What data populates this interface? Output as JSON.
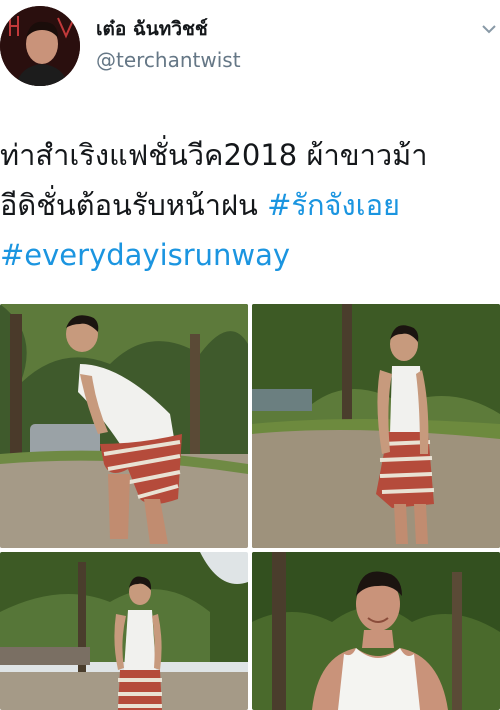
{
  "tweet": {
    "author": {
      "display_name": "เต๋อ ฉันทวิชช์",
      "handle": "@terchantwist",
      "avatar_icon": "profile-avatar"
    },
    "menu_icon": "chevron-down-icon",
    "text_lines": [
      {
        "text": "ท่าสำเริงแฟชั่นวีค2018 ผ้าขาวม้า",
        "hashtag": ""
      },
      {
        "text": "อีดิชั่นต้อนรับหน้าฝน ",
        "hashtag": "#รักจังเอย"
      },
      {
        "text": "",
        "hashtag": "#everydayisrunway"
      }
    ],
    "hashtag_color": "#1b95e0",
    "photos": [
      {
        "icon": "photo-man-bending-forward"
      },
      {
        "icon": "photo-man-standing-looking-down"
      },
      {
        "icon": "photo-man-standing-path"
      },
      {
        "icon": "photo-man-closeup-smiling"
      }
    ]
  }
}
